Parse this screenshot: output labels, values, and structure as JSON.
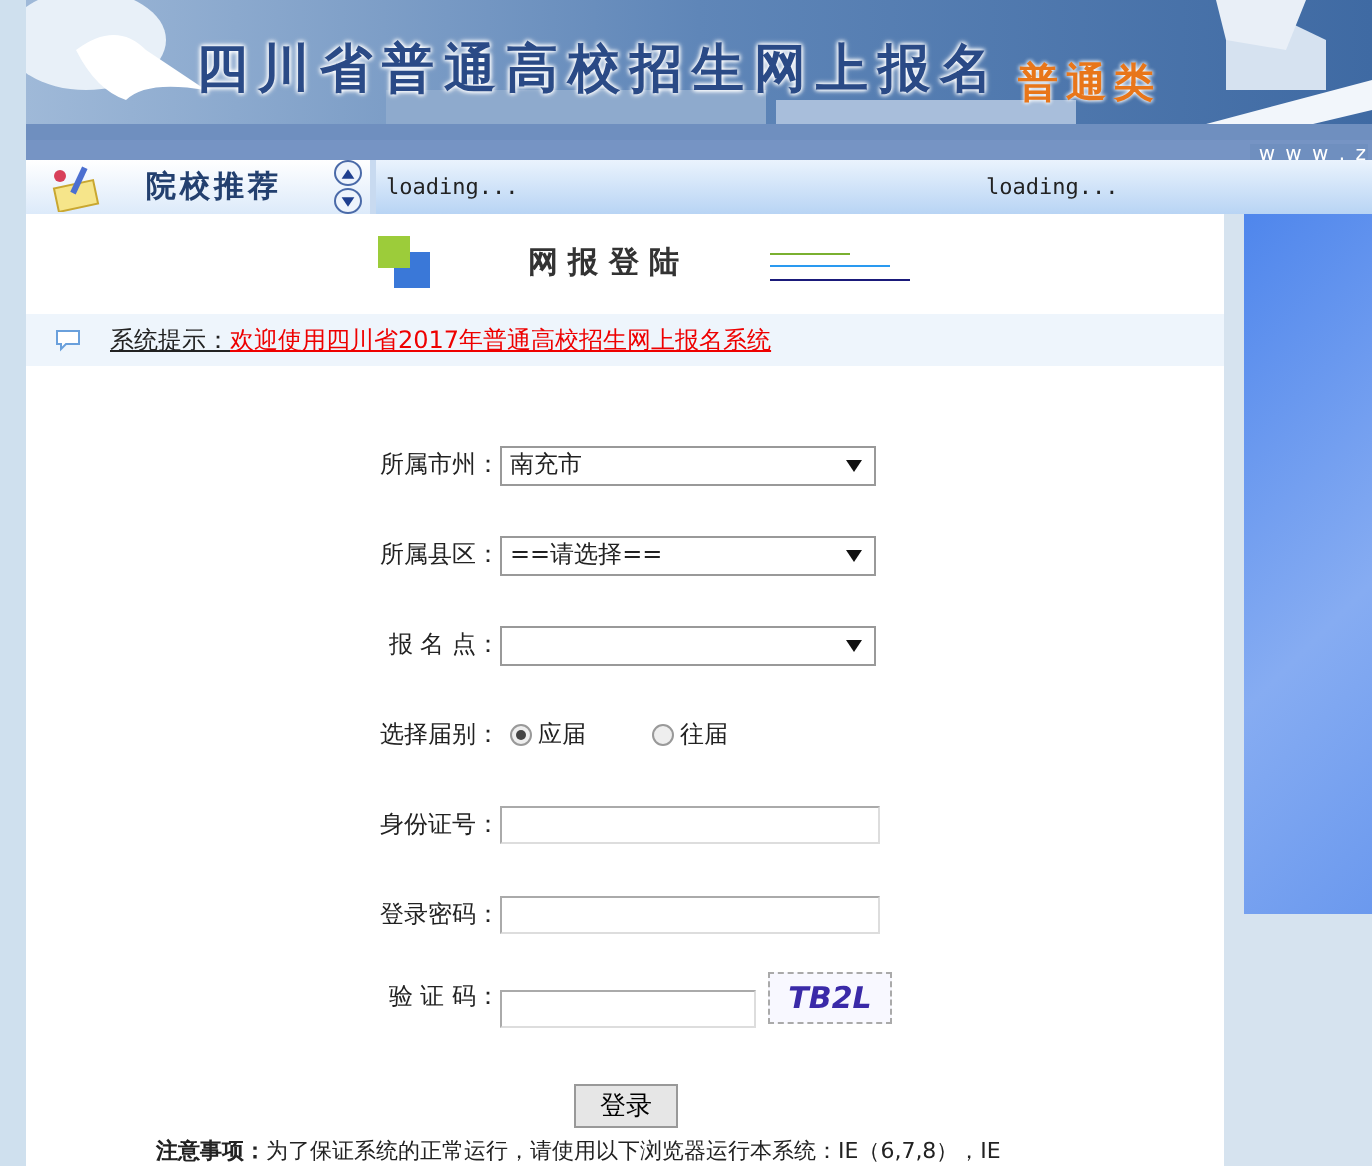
{
  "banner": {
    "title": "四川省普通高校招生网上报名",
    "category": "普通类",
    "url_fragment": "w w w . z"
  },
  "sidebar_header": {
    "title": "院校推荐"
  },
  "ticker": [
    "loading...",
    "loading..."
  ],
  "login": {
    "title": "网 报 登 陆"
  },
  "notice": {
    "label": "系统提示：",
    "message": "欢迎使用四川省2017年普通高校招生网上报名系统"
  },
  "fields": [
    {
      "kind": "select",
      "label": "所属市州：",
      "value": "南充市"
    },
    {
      "kind": "select",
      "label": "所属县区：",
      "value": "==请选择=="
    },
    {
      "kind": "select",
      "label": "报 名 点："
    },
    {
      "kind": "radio",
      "label": "选择届别：",
      "options": [
        {
          "label": "应届",
          "selected": true
        },
        {
          "label": "往届",
          "selected": false
        }
      ]
    },
    {
      "kind": "input",
      "label": "身份证号："
    },
    {
      "kind": "input",
      "label": "登录密码："
    },
    {
      "kind": "captcha",
      "label": "验 证 码：",
      "captcha": "TB2L"
    }
  ],
  "submit": "登录",
  "footnote": "**注意事项：**为了保证系统的正常运行，请使用以下浏览器运行本系统：IE（6,7,8），IE"
}
